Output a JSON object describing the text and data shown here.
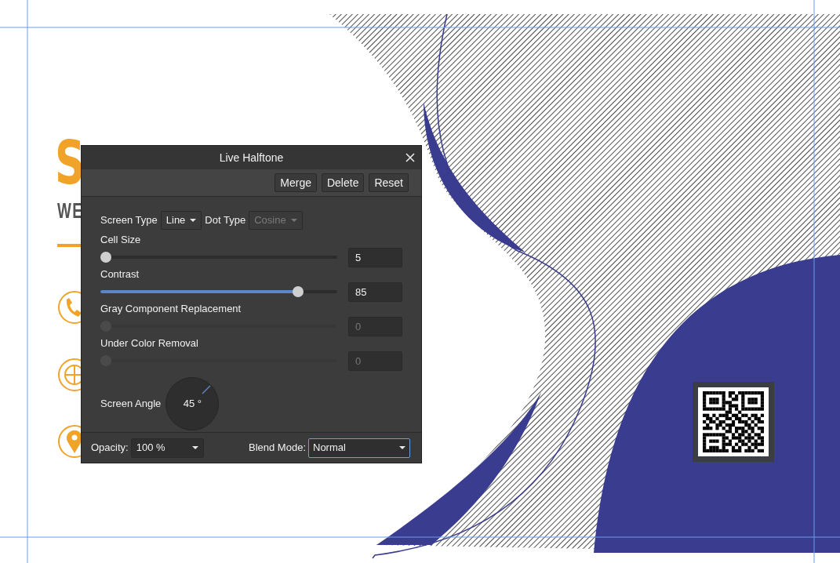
{
  "canvas": {
    "heading_letter": "S",
    "subheading": "WE"
  },
  "dialog": {
    "title": "Live Halftone",
    "buttons": [
      "Merge",
      "Delete",
      "Reset"
    ],
    "screen_type": {
      "label": "Screen Type",
      "value": "Line",
      "disabled": false
    },
    "dot_type": {
      "label": "Dot Type",
      "value": "Cosine",
      "disabled": true
    },
    "sliders": [
      {
        "label": "Cell Size",
        "level": 0,
        "value": "5",
        "disabled": false
      },
      {
        "label": "Contrast",
        "level": 0.85,
        "value": "85",
        "disabled": false
      },
      {
        "label": "Gray Component Replacement",
        "level": 0,
        "value": "0",
        "disabled": true
      },
      {
        "label": "Under Color Removal",
        "level": 0,
        "value": "0",
        "disabled": true
      }
    ],
    "screen_angle": {
      "label": "Screen Angle",
      "value": "45 °"
    },
    "opacity": {
      "label": "Opacity:",
      "value": "100 %"
    },
    "blend_mode": {
      "label": "Blend Mode:",
      "value": "Normal",
      "focused": true
    }
  }
}
